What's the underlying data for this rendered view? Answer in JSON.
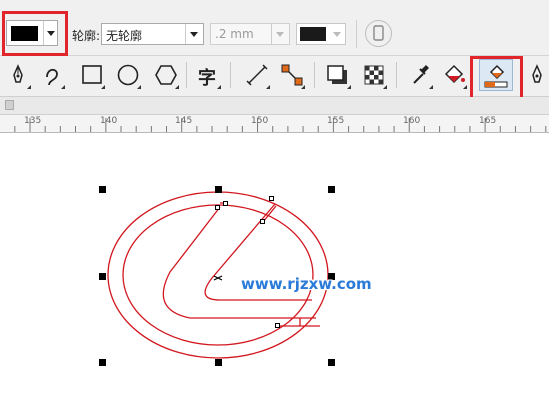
{
  "property_bar": {
    "fill_color": "#000000",
    "outline_label": "轮廓:",
    "outline_value": "无轮廓",
    "width_value": ".2 mm",
    "outline_color": "#1a1a1a"
  },
  "ruler": {
    "ticks": [
      "135",
      "140",
      "145",
      "150",
      "155",
      "160",
      "165"
    ]
  },
  "toolbar": {
    "text_tool_glyph": "字"
  },
  "canvas": {
    "watermark": "www.rjzxw.com",
    "stroke_color": "#d2161e"
  },
  "highlight_color": "#e0262b"
}
